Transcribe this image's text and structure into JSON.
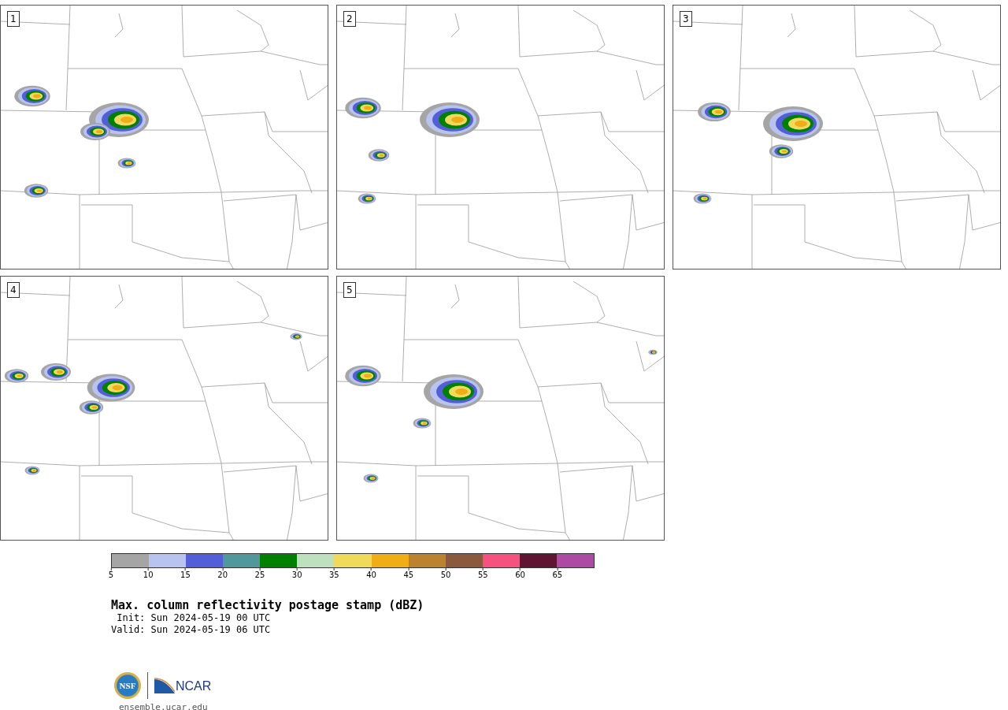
{
  "panels": [
    {
      "number": "1"
    },
    {
      "number": "2"
    },
    {
      "number": "3"
    },
    {
      "number": "4"
    },
    {
      "number": "5"
    }
  ],
  "colorbar": [
    {
      "label": "5",
      "color": "#a5a5a5"
    },
    {
      "label": "10",
      "color": "#b8c3ef"
    },
    {
      "label": "15",
      "color": "#525fd8"
    },
    {
      "label": "20",
      "color": "#50989c"
    },
    {
      "label": "25",
      "color": "#008000"
    },
    {
      "label": "30",
      "color": "#bfe0bf"
    },
    {
      "label": "35",
      "color": "#f0da5c"
    },
    {
      "label": "40",
      "color": "#f0ad17"
    },
    {
      "label": "45",
      "color": "#bb822f"
    },
    {
      "label": "50",
      "color": "#8b5a3e"
    },
    {
      "label": "55",
      "color": "#f65280"
    },
    {
      "label": "60",
      "color": "#5f1532"
    },
    {
      "label": "65",
      "color": "#ad4aa3"
    }
  ],
  "title": "Max. column reflectivity postage stamp (dBZ)",
  "init": " Init: Sun 2024-05-19 00 UTC",
  "valid": "Valid: Sun 2024-05-19 06 UTC",
  "logos": {
    "nsf": "NSF",
    "ncar": "NCAR"
  },
  "url": "ensemble.ucar.edu"
}
